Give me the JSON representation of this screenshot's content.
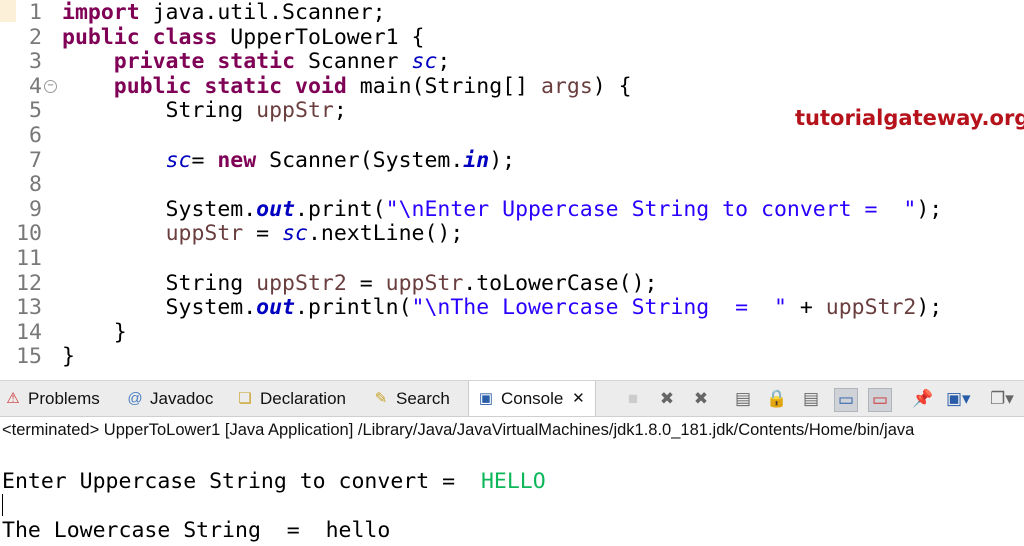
{
  "editor": {
    "lines": [
      {
        "n": "1",
        "t": [
          [
            "kw",
            "import"
          ],
          [
            "plain",
            " java.util.Scanner;"
          ]
        ]
      },
      {
        "n": "2",
        "t": [
          [
            "kw",
            "public"
          ],
          [
            "plain",
            " "
          ],
          [
            "kw",
            "class"
          ],
          [
            "plain",
            " UpperToLower1 {"
          ]
        ]
      },
      {
        "n": "3",
        "t": [
          [
            "plain",
            "    "
          ],
          [
            "kw",
            "private"
          ],
          [
            "plain",
            " "
          ],
          [
            "kw",
            "static"
          ],
          [
            "plain",
            " Scanner "
          ],
          [
            "field",
            "sc"
          ],
          [
            "plain",
            ";"
          ]
        ]
      },
      {
        "n": "4",
        "t": [
          [
            "plain",
            "    "
          ],
          [
            "kw",
            "public"
          ],
          [
            "plain",
            " "
          ],
          [
            "kw",
            "static"
          ],
          [
            "plain",
            " "
          ],
          [
            "kw",
            "void"
          ],
          [
            "plain",
            " main(String[] "
          ],
          [
            "var",
            "args"
          ],
          [
            "plain",
            ") {"
          ]
        ]
      },
      {
        "n": "5",
        "t": [
          [
            "plain",
            "        String "
          ],
          [
            "var",
            "uppStr"
          ],
          [
            "plain",
            ";"
          ]
        ]
      },
      {
        "n": "6",
        "t": []
      },
      {
        "n": "7",
        "t": [
          [
            "plain",
            "        "
          ],
          [
            "field",
            "sc"
          ],
          [
            "plain",
            "= "
          ],
          [
            "kw",
            "new"
          ],
          [
            "plain",
            " Scanner(System."
          ],
          [
            "sfield",
            "in"
          ],
          [
            "plain",
            ");"
          ]
        ]
      },
      {
        "n": "8",
        "t": []
      },
      {
        "n": "9",
        "t": [
          [
            "plain",
            "        System."
          ],
          [
            "sfield",
            "out"
          ],
          [
            "plain",
            ".print("
          ],
          [
            "str",
            "\"\\nEnter Uppercase String to convert =  \""
          ],
          [
            "plain",
            ");"
          ]
        ]
      },
      {
        "n": "10",
        "t": [
          [
            "plain",
            "        "
          ],
          [
            "var",
            "uppStr"
          ],
          [
            "plain",
            " = "
          ],
          [
            "field",
            "sc"
          ],
          [
            "plain",
            ".nextLine();"
          ]
        ]
      },
      {
        "n": "11",
        "t": []
      },
      {
        "n": "12",
        "t": [
          [
            "plain",
            "        String "
          ],
          [
            "var",
            "uppStr2"
          ],
          [
            "plain",
            " = "
          ],
          [
            "var",
            "uppStr"
          ],
          [
            "plain",
            ".toLowerCase();"
          ]
        ]
      },
      {
        "n": "13",
        "t": [
          [
            "plain",
            "        System."
          ],
          [
            "sfield",
            "out"
          ],
          [
            "plain",
            ".println("
          ],
          [
            "str",
            "\"\\nThe Lowercase String  =  \""
          ],
          [
            "plain",
            " + "
          ],
          [
            "var",
            "uppStr2"
          ],
          [
            "plain",
            ");"
          ]
        ]
      },
      {
        "n": "14",
        "t": [
          [
            "plain",
            "    }"
          ]
        ]
      },
      {
        "n": "15",
        "t": [
          [
            "plain",
            "}"
          ]
        ]
      }
    ],
    "watermark": "tutorialgateway.org"
  },
  "tabs": {
    "problems": "Problems",
    "javadoc": "Javadoc",
    "declaration": "Declaration",
    "search": "Search",
    "console": "Console"
  },
  "console": {
    "status": "<terminated> UpperToLower1 [Java Application] /Library/Java/JavaVirtualMachines/jdk1.8.0_181.jdk/Contents/Home/bin/java",
    "prompt": "Enter Uppercase String to convert =  ",
    "input": "HELLO",
    "result": "The Lowercase String  =  hello"
  }
}
